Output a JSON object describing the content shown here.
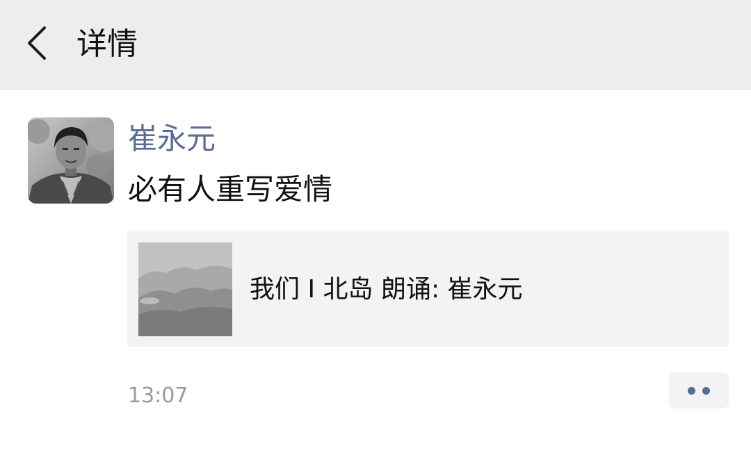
{
  "header": {
    "title": "详情",
    "back_icon": "chevron-left-icon"
  },
  "post": {
    "author": "崔永元",
    "text": "必有人重写爱情",
    "share": {
      "title": "我们 I 北岛   朗诵: 崔永元"
    },
    "timestamp": "13:07",
    "more_icon": "more-dots-icon"
  },
  "colors": {
    "header_bg": "#ededed",
    "link_blue": "#576b95",
    "card_bg": "#f3f3f5",
    "timestamp_gray": "#9a9a9a"
  }
}
